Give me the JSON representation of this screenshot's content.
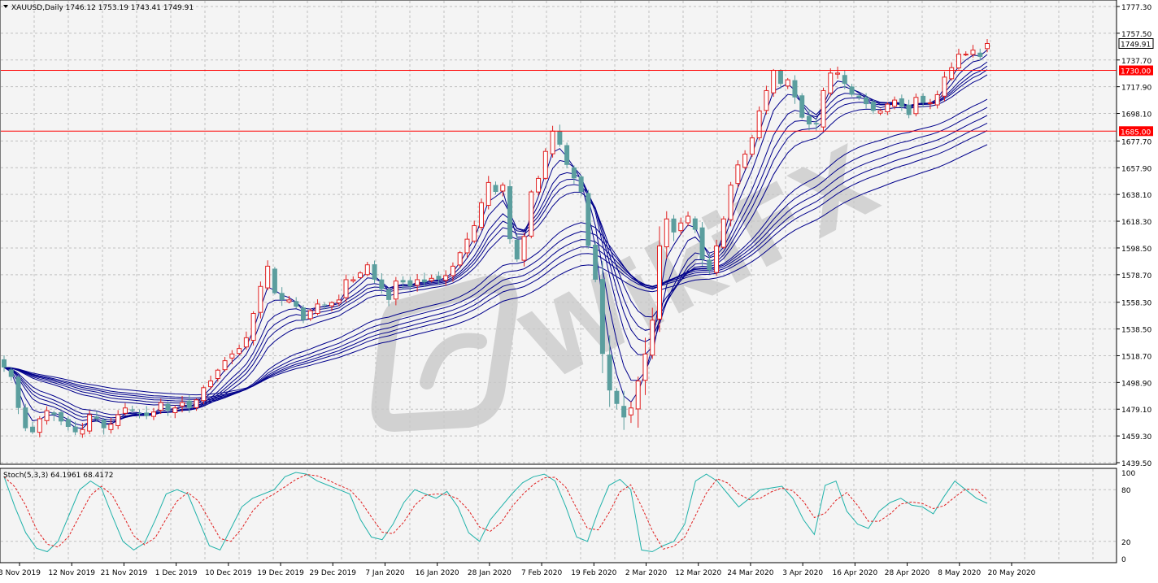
{
  "header": {
    "symbol_line": "XAUUSD,Daily  1746.12 1753.19 1743.41 1749.91",
    "menu_icon": "triangle-down-icon"
  },
  "indicator": {
    "label": "Stoch(5,3,3) 64.1961 68.4172",
    "levels": [
      100,
      80,
      20,
      0
    ],
    "main_color": "#20b2aa",
    "signal_color": "#e02020"
  },
  "watermark": {
    "text": "WikiFX",
    "icon": "wikifx-logo-icon"
  },
  "colors": {
    "background": "#f4f4f4",
    "bull_candle": "#e02020",
    "bear_candle": "#5b9e9e",
    "ma_ribbon": "#00008b",
    "level_line": "#ff0000",
    "grid": "#c0c0c0"
  },
  "chart_data": [
    {
      "type": "candlestick",
      "title": "XAUUSD,Daily",
      "ohlc_current": {
        "open": 1746.12,
        "high": 1753.19,
        "low": 1743.41,
        "close": 1749.91
      },
      "current_price_tag": "1749.91",
      "ylim": [
        1439.5,
        1777.3
      ],
      "y_ticks": [
        1777.3,
        1757.5,
        1737.7,
        1717.9,
        1698.1,
        1677.7,
        1657.9,
        1638.1,
        1618.3,
        1598.5,
        1578.7,
        1558.3,
        1538.5,
        1518.7,
        1498.9,
        1479.1,
        1459.3,
        1439.5
      ],
      "y_tick_labels": [
        "1777.30",
        "1757.50",
        "1737.70",
        "1717.90",
        "1698.10",
        "1677.70",
        "1657.90",
        "1638.10",
        "1618.30",
        "1598.50",
        "1578.70",
        "1558.30",
        "1538.50",
        "1518.70",
        "1498.90",
        "1479.10",
        "1459.30",
        "1439.50"
      ],
      "x_tick_labels": [
        "3 Nov 2019",
        "12 Nov 2019",
        "21 Nov 2019",
        "1 Dec 2019",
        "10 Dec 2019",
        "19 Dec 2019",
        "29 Dec 2019",
        "7 Jan 2020",
        "16 Jan 2020",
        "28 Jan 2020",
        "7 Feb 2020",
        "19 Feb 2020",
        "2 Mar 2020",
        "12 Mar 2020",
        "24 Mar 2020",
        "3 Apr 2020",
        "16 Apr 2020",
        "28 Apr 2020",
        "8 May 2020",
        "20 May 2020"
      ],
      "horizontal_levels": [
        {
          "value": 1730.0,
          "label": "1730.00"
        },
        {
          "value": 1685.0,
          "label": "1685.00"
        }
      ],
      "close_path": [
        1510,
        1503,
        1480,
        1465,
        1462,
        1472,
        1478,
        1475,
        1470,
        1466,
        1462,
        1464,
        1475,
        1472,
        1465,
        1468,
        1475,
        1480,
        1478,
        1476,
        1474,
        1477,
        1484,
        1478,
        1480,
        1484,
        1480,
        1486,
        1495,
        1500,
        1508,
        1515,
        1520,
        1524,
        1532,
        1550,
        1570,
        1585,
        1565,
        1560,
        1560,
        1555,
        1545,
        1552,
        1557,
        1556,
        1558,
        1560,
        1575,
        1575,
        1580,
        1586,
        1575,
        1568,
        1560,
        1574,
        1573,
        1570,
        1575,
        1573,
        1576,
        1575,
        1578,
        1585,
        1595,
        1605,
        1615,
        1632,
        1647,
        1640,
        1645,
        1605,
        1590,
        1607,
        1640,
        1650,
        1670,
        1685,
        1675,
        1660,
        1650,
        1640,
        1600,
        1575,
        1520,
        1493,
        1483,
        1473,
        1480,
        1500,
        1520,
        1545,
        1600,
        1620,
        1610,
        1617,
        1622,
        1612,
        1590,
        1582,
        1600,
        1620,
        1645,
        1660,
        1668,
        1680,
        1700,
        1715,
        1730,
        1720,
        1723,
        1710,
        1695,
        1690,
        1690,
        1715,
        1728,
        1728,
        1720,
        1712,
        1710,
        1705,
        1700,
        1700,
        1705,
        1708,
        1703,
        1697,
        1710,
        1706,
        1706,
        1712,
        1725,
        1732,
        1742,
        1742,
        1745,
        1740,
        1750
      ],
      "stochastic": {
        "name": "Stoch(5,3,3)",
        "main_last": 64.1961,
        "signal_last": 68.4172,
        "ylim": [
          0,
          100
        ],
        "y_tick_labels": [
          "100",
          "80",
          "20",
          "0"
        ],
        "dashed_levels": [
          80,
          20
        ],
        "main_shape": [
          95,
          60,
          30,
          12,
          8,
          20,
          50,
          80,
          90,
          82,
          50,
          20,
          10,
          18,
          45,
          75,
          80,
          75,
          45,
          15,
          10,
          35,
          60,
          70,
          75,
          80,
          95,
          100,
          98,
          90,
          85,
          80,
          75,
          45,
          25,
          22,
          40,
          65,
          80,
          75,
          70,
          78,
          60,
          30,
          20,
          45,
          60,
          75,
          88,
          95,
          98,
          90,
          60,
          25,
          20,
          55,
          85,
          92,
          80,
          10,
          8,
          15,
          20,
          40,
          90,
          98,
          90,
          75,
          60,
          70,
          80,
          82,
          84,
          70,
          45,
          28,
          85,
          90,
          55,
          40,
          35,
          55,
          65,
          70,
          62,
          60,
          52,
          72,
          90,
          80,
          70,
          64
        ]
      }
    }
  ]
}
